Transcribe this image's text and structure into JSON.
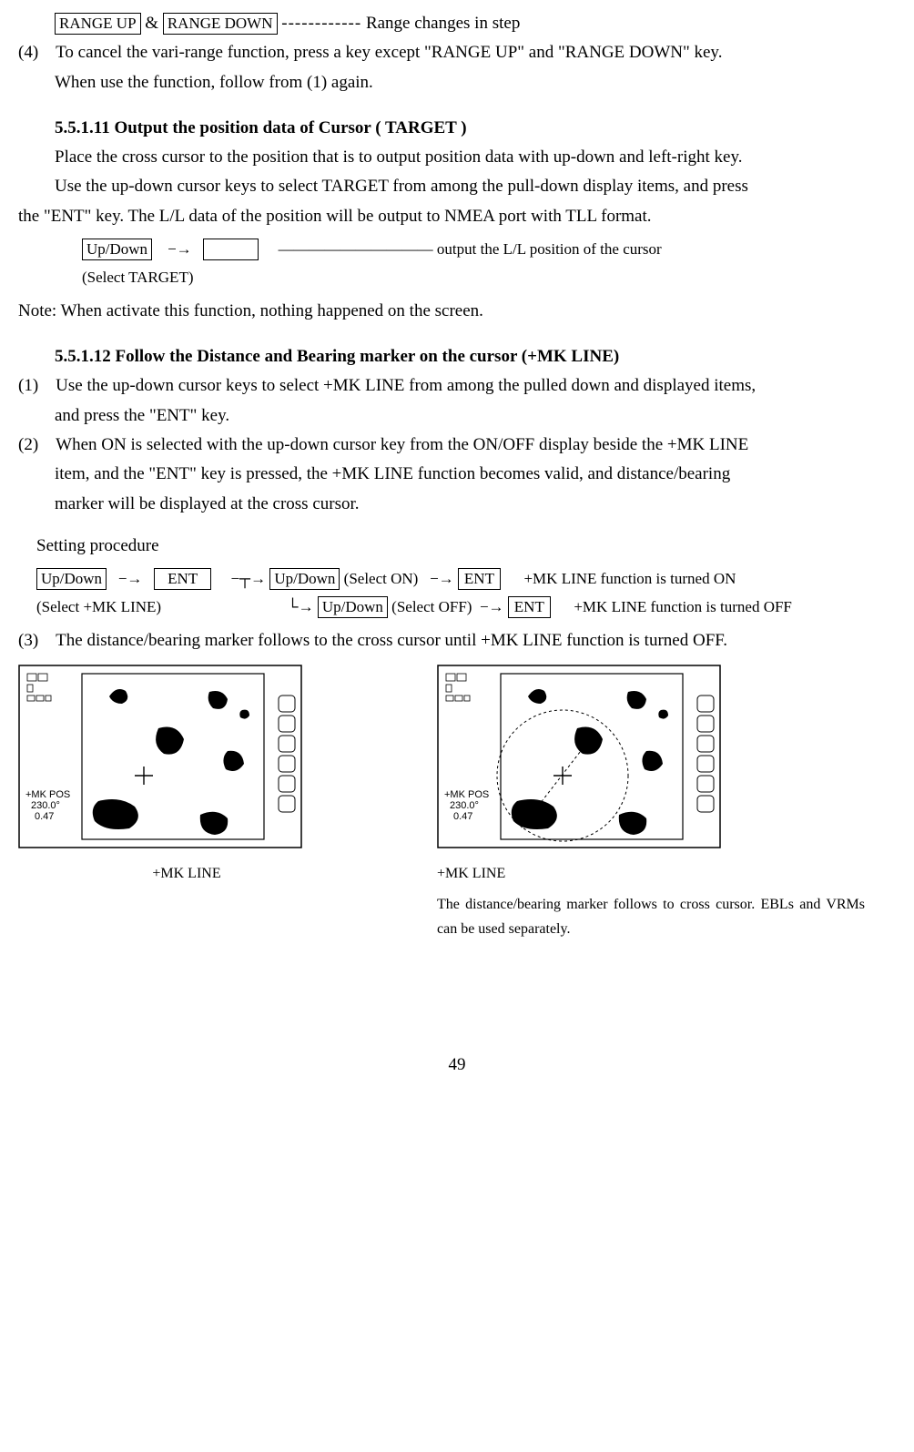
{
  "line1": {
    "btn1": "RANGE UP",
    "amp": "&",
    "btn2": "RANGE DOWN",
    "dash": "------------",
    "rest": "Range changes in step"
  },
  "p4a": "(4) To cancel the vari-range function, press a key except \"RANGE UP\" and \"RANGE DOWN\" key.",
  "p4b": "When use the function, follow from (1) again.",
  "h11": "5.5.1.11 Output the position data of Cursor ( TARGET )",
  "h11p1": "Place the cross cursor to the position that is to output position data with up-down and left-right key.",
  "h11p2": "Use the up-down cursor keys to select TARGET from among the pull-down display items, and press",
  "h11p3": "the \"ENT\" key. The L/L data of the position will be output to NMEA port with TLL format.",
  "proc11": {
    "k1": "Up/Down",
    "arrow": "−→",
    "blank": "　　　",
    "longdash": "　――――――――――",
    "out": "output the L/L position of the cursor",
    "sel": "(Select TARGET)"
  },
  "note11": "Note: When activate this function, nothing happened on the screen.",
  "h12": "5.5.1.12 Follow the Distance and Bearing marker on the cursor (+MK LINE)",
  "p12_1a": "(1) Use the up-down cursor keys to select +MK LINE from among the pulled down and displayed items,",
  "p12_1b": "and press the \"ENT\" key.",
  "p12_2a": "(2) When ON is selected with the up-down cursor key from the ON/OFF display beside the +MK LINE",
  "p12_2b": "item, and the \"ENT\" key is pressed, the +MK LINE function becomes valid, and distance/bearing",
  "p12_2c": "marker will be displayed at the cross cursor.",
  "setproc": "Setting procedure",
  "proc12": {
    "k_ud": "Up/Down",
    "k_ent": "ENT",
    "sel_mk": "(Select +MK LINE)",
    "sel_on": "(Select ON)",
    "sel_off": "(Select OFF)",
    "res_on": "+MK LINE function is turned ON",
    "res_off": "+MK LINE function is turned OFF"
  },
  "p12_3": "(3) The distance/bearing marker follows to the cross cursor until +MK LINE function is turned OFF.",
  "fig": {
    "pos_label": "+MK POS",
    "bearing": "230.0°",
    "range": "0.47",
    "cap_left": "+MK LINE　　　",
    "cap_right_title": "+MK LINE　　　　",
    "cap_right_body": "The distance/bearing marker follows to cross cursor. EBLs and VRMs can be used separately."
  },
  "page": "49"
}
